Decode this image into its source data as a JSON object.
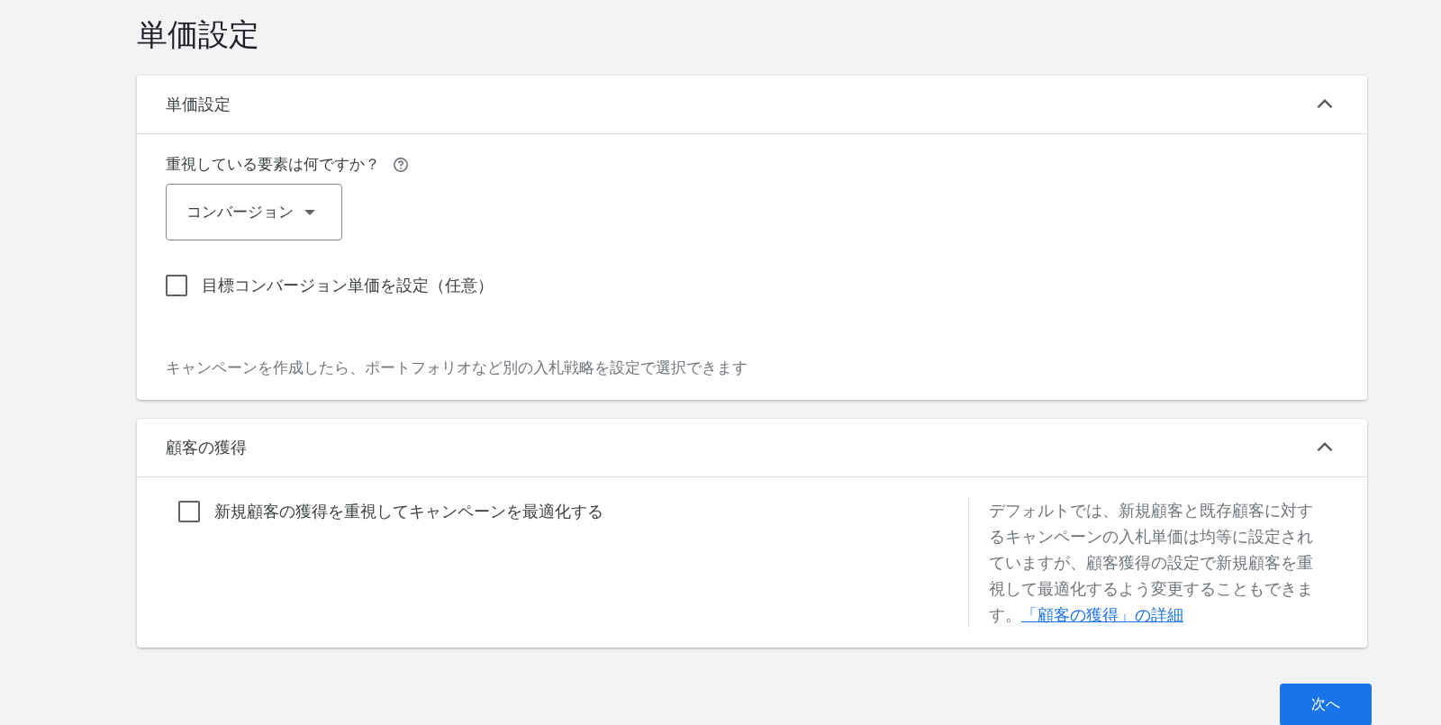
{
  "page_title": "単価設定",
  "sections": [
    {
      "kind": "bidding",
      "title": "単価設定",
      "expanded": true,
      "question": "重視している要素は何ですか？",
      "dropdown": {
        "value": "コンバージョン"
      },
      "checkbox": {
        "label": "目標コンバージョン単価を設定（任意）",
        "checked": false
      },
      "note": "キャンペーンを作成したら、ポートフォリオなど別の入札戦略を設定で選択できます"
    },
    {
      "kind": "acquisition",
      "title": "顧客の獲得",
      "expanded": true,
      "checkbox": {
        "label": "新規顧客の獲得を重視してキャンペーンを最適化する",
        "checked": false
      },
      "description": "デフォルトでは、新規顧客と既存顧客に対するキャンペーンの入札単価は均等に設定されていますが、顧客獲得の設定で新規顧客を重視して最適化するよう変更することもできます。",
      "link": "「顧客の獲得」の詳細"
    }
  ],
  "next_button": "次へ"
}
